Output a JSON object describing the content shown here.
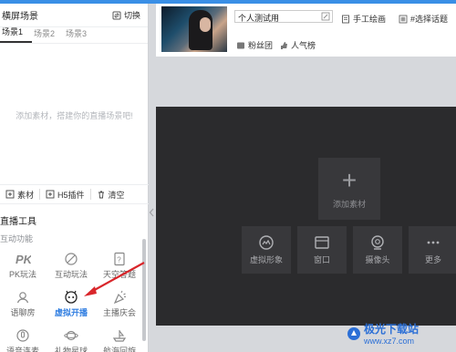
{
  "left_panel": {
    "title": "横屏场景",
    "switch_label": "切换",
    "tabs": [
      "场景1",
      "场景2",
      "场景3"
    ],
    "empty_message": "添加素材，搭建你的直播场景吧!",
    "tools": [
      {
        "icon": "plus-icon",
        "label": "素材"
      },
      {
        "icon": "plus-icon",
        "label": "H5插件"
      },
      {
        "icon": "trash-icon",
        "label": "清空"
      }
    ],
    "section_title": "直播工具",
    "sub_title": "互动功能",
    "grid": [
      {
        "icon": "pk-icon",
        "label": "PK玩法"
      },
      {
        "icon": "interactive-icon",
        "label": "互动玩法"
      },
      {
        "icon": "question-icon",
        "label": "天空答题"
      },
      {
        "icon": "voice-room-icon",
        "label": "语聊房"
      },
      {
        "icon": "virtual-stream-icon",
        "label": "虚拟开播"
      },
      {
        "icon": "party-icon",
        "label": "主播庆会"
      },
      {
        "icon": "voice-link-icon",
        "label": "语音连麦"
      },
      {
        "icon": "gift-planet-icon",
        "label": "礼物星球"
      },
      {
        "icon": "voyage-icon",
        "label": "航海回旋"
      }
    ]
  },
  "info_card": {
    "title_value": "个人测试用",
    "tags": [
      {
        "icon": "book-icon",
        "label": "手工绘画"
      },
      {
        "icon": "hashtag-icon",
        "label": "#选择话题"
      },
      {
        "icon": "fan-group-icon",
        "label": "粉丝团"
      },
      {
        "icon": "thumb-icon",
        "label": "人气榜"
      }
    ]
  },
  "stage": {
    "add_label": "添加素材",
    "buttons": [
      {
        "icon": "avatar-icon",
        "label": "虚拟形象"
      },
      {
        "icon": "window-icon",
        "label": "窗口"
      },
      {
        "icon": "camera-icon",
        "label": "摄像头"
      },
      {
        "icon": "more-icon",
        "label": "更多"
      }
    ]
  },
  "watermark": {
    "line1": "极光下载站",
    "line2": "www.xz7.com"
  },
  "colors": {
    "accent": "#2f7de1",
    "arrow": "#d9262b",
    "stage_bg": "#2b2b2d",
    "tile_bg": "#38383b"
  }
}
